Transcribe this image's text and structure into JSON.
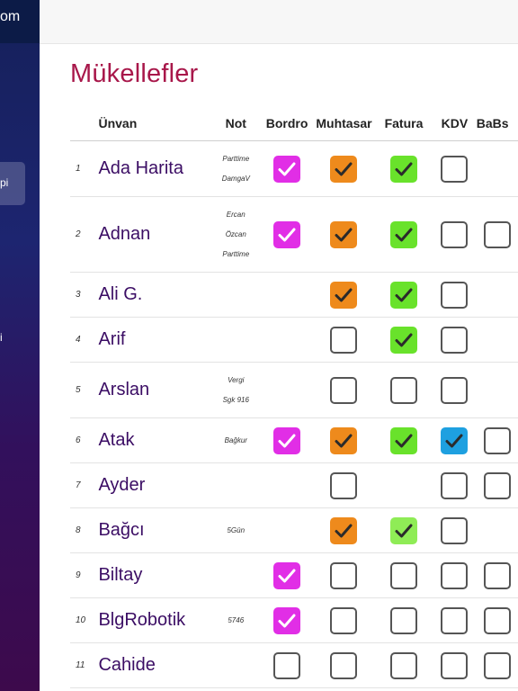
{
  "sidebar": {
    "brand_fragment": "om",
    "active_item_fragment": "pi",
    "item_fragment": "i"
  },
  "page": {
    "title": "Mükellefler"
  },
  "table": {
    "headers": [
      "Ünvan",
      "Not",
      "Bordro",
      "Muhtasar",
      "Fatura",
      "KDV",
      "BaBs"
    ],
    "rows": [
      {
        "no": "1",
        "name": "Ada Harita",
        "notes": [
          "Parttime",
          "DamgaV"
        ],
        "bordro": "checked",
        "muhtasar": "checked",
        "fatura": "checked",
        "kdv": "empty",
        "babs": "none"
      },
      {
        "no": "2",
        "name": "Adnan",
        "notes": [
          "Ercan",
          "Özcan",
          "Parttime"
        ],
        "bordro": "checked",
        "muhtasar": "checked",
        "fatura": "checked",
        "kdv": "empty",
        "babs": "empty"
      },
      {
        "no": "3",
        "name": "Ali G.",
        "notes": [],
        "bordro": "none",
        "muhtasar": "checked",
        "fatura": "checked",
        "kdv": "empty",
        "babs": "none"
      },
      {
        "no": "4",
        "name": "Arif",
        "notes": [],
        "bordro": "none",
        "muhtasar": "empty",
        "fatura": "checked",
        "kdv": "empty",
        "babs": "none"
      },
      {
        "no": "5",
        "name": "Arslan",
        "notes": [
          "Vergi",
          "Sgk 916"
        ],
        "bordro": "none",
        "muhtasar": "empty",
        "fatura": "empty",
        "kdv": "empty",
        "babs": "none"
      },
      {
        "no": "6",
        "name": "Atak",
        "notes": [
          "Bağkur"
        ],
        "bordro": "checked",
        "muhtasar": "checked",
        "fatura": "checked",
        "kdv": "checked",
        "babs": "empty"
      },
      {
        "no": "7",
        "name": "Ayder",
        "notes": [],
        "bordro": "none",
        "muhtasar": "empty",
        "fatura": "none",
        "kdv": "empty",
        "babs": "empty"
      },
      {
        "no": "8",
        "name": "Bağcı",
        "notes": [
          "5Gün"
        ],
        "bordro": "none",
        "muhtasar": "checked",
        "fatura": "checked_light",
        "kdv": "empty",
        "babs": "none"
      },
      {
        "no": "9",
        "name": "Biltay",
        "notes": [],
        "bordro": "checked",
        "muhtasar": "empty",
        "fatura": "empty",
        "kdv": "empty",
        "babs": "empty"
      },
      {
        "no": "10",
        "name": "BlgRobotik",
        "notes": [
          "5746"
        ],
        "bordro": "checked",
        "muhtasar": "empty",
        "fatura": "empty",
        "kdv": "empty",
        "babs": "empty"
      },
      {
        "no": "11",
        "name": "Cahide",
        "notes": [],
        "bordro": "empty",
        "muhtasar": "empty",
        "fatura": "empty",
        "kdv": "empty",
        "babs": "empty"
      }
    ]
  },
  "colors": {
    "bordro": "#e12ee6",
    "muhtasar": "#ee8a1c",
    "fatura": "#69e22b",
    "fatura_light": "#8fec56",
    "kdv": "#1ea0e0",
    "title": "#a8174a",
    "name": "#3b0d64"
  }
}
